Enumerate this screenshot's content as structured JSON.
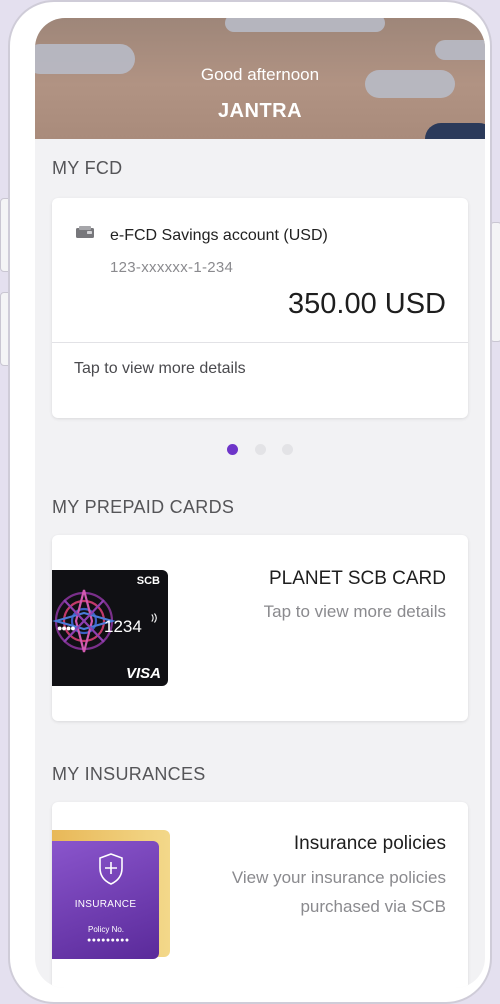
{
  "header": {
    "greeting": "Good afternoon",
    "user_name": "JANTRA"
  },
  "fcd": {
    "section_title": "MY FCD",
    "account_icon": "wallet-icon",
    "account_name": "e-FCD Savings account (USD)",
    "account_number": "123-xxxxxx-1-234",
    "balance": "350.00 USD",
    "tap_text": "Tap to view more details",
    "pagination": {
      "total": 3,
      "active": 1
    }
  },
  "prepaid": {
    "section_title": "MY PREPAID CARDS",
    "card_name": "PLANET SCB CARD",
    "tap_text": "Tap to view more details",
    "card_image": {
      "brand": "SCB",
      "number": "1234",
      "masked_dots": "●●●●",
      "network": "VISA"
    }
  },
  "insurance": {
    "section_title": "MY INSURANCES",
    "title": "Insurance policies",
    "subtitle_line1": "View your insurance policies",
    "subtitle_line2": "purchased via SCB",
    "card_image": {
      "label": "INSURANCE",
      "policy_label": "Policy No.",
      "policy_dots": "●●●●●●●●●"
    }
  },
  "colors": {
    "accent": "#6e35c9",
    "background": "#f2f2f4",
    "header": "#a98b7b"
  }
}
